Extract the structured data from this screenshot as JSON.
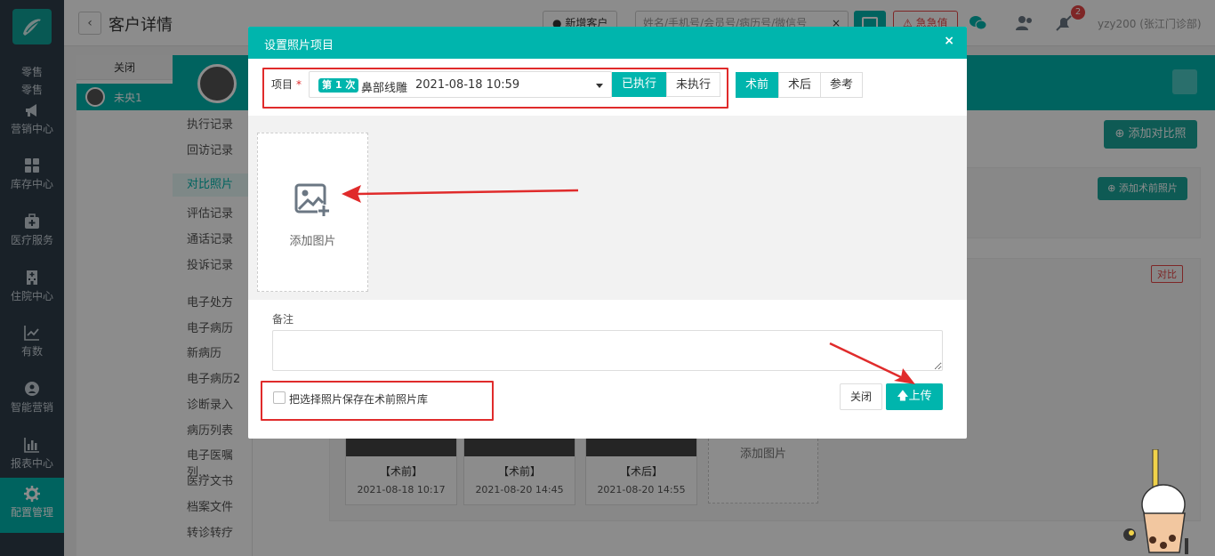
{
  "nav": {
    "items": [
      {
        "label": "零售",
        "icon": "cart-icon"
      },
      {
        "label": "营销中心",
        "icon": "megaphone-icon"
      },
      {
        "label": "库存中心",
        "icon": "grid-icon"
      },
      {
        "label": "医疗服务",
        "icon": "medkit-icon"
      },
      {
        "label": "住院中心",
        "icon": "hospital-icon"
      },
      {
        "label": "有数",
        "icon": "chart-line-icon"
      },
      {
        "label": "智能营销",
        "icon": "brain-icon"
      },
      {
        "label": "报表中心",
        "icon": "bar-chart-icon"
      },
      {
        "label": "配置管理",
        "icon": "gear-icon"
      }
    ]
  },
  "topbar": {
    "back": "‹",
    "title": "客户详情",
    "new_customer": "新增客户",
    "search_placeholder": "姓名/手机号/会员号/病历号/微信号",
    "search_clear": "×",
    "urgent": "急急值",
    "notification_count": "2",
    "user": "yzy200 (张江门诊部)"
  },
  "clinic": {
    "tab": "关闭",
    "patient": "未央1"
  },
  "side_menu": [
    "执行记录",
    "回访记录",
    "对比照片",
    "评估记录",
    "通话记录",
    "投诉记录",
    "电子处方",
    "电子病历",
    "新病历",
    "电子病历2",
    "诊断录入",
    "病历列表",
    "电子医嘱列...",
    "医疗文书",
    "档案文件",
    "转诊转疗"
  ],
  "content": {
    "add_compare": "添加对比照",
    "add_preop": "添加术前照片",
    "compare_tag": "对比",
    "thumbs": [
      {
        "tag": "【术前】",
        "date": "2021-08-18 10:17"
      },
      {
        "tag": "【术前】",
        "date": "2021-08-20 14:45"
      },
      {
        "tag": "【术后】",
        "date": "2021-08-20 14:55"
      }
    ],
    "add_image": "添加图片"
  },
  "modal": {
    "title": "设置照片项目",
    "close_icon": "×",
    "project_label": "项目",
    "required_mark": "*",
    "project_badge": "第 1 次",
    "project_name": "鼻部线雕",
    "project_date": "2021-08-18 10:59",
    "executed": "已执行",
    "not_executed": "未执行",
    "stages": [
      "术前",
      "术后",
      "参考"
    ],
    "active_stage": "术前",
    "add_image": "添加图片",
    "note_label": "备注",
    "note_value": "",
    "save_checkbox": "把选择照片保存在术前照片库",
    "close": "关闭",
    "upload": "上传"
  },
  "colors": {
    "accent": "#00b5ad",
    "nav_bg": "#2f3d4a",
    "annotation_red": "#e02b2b"
  }
}
